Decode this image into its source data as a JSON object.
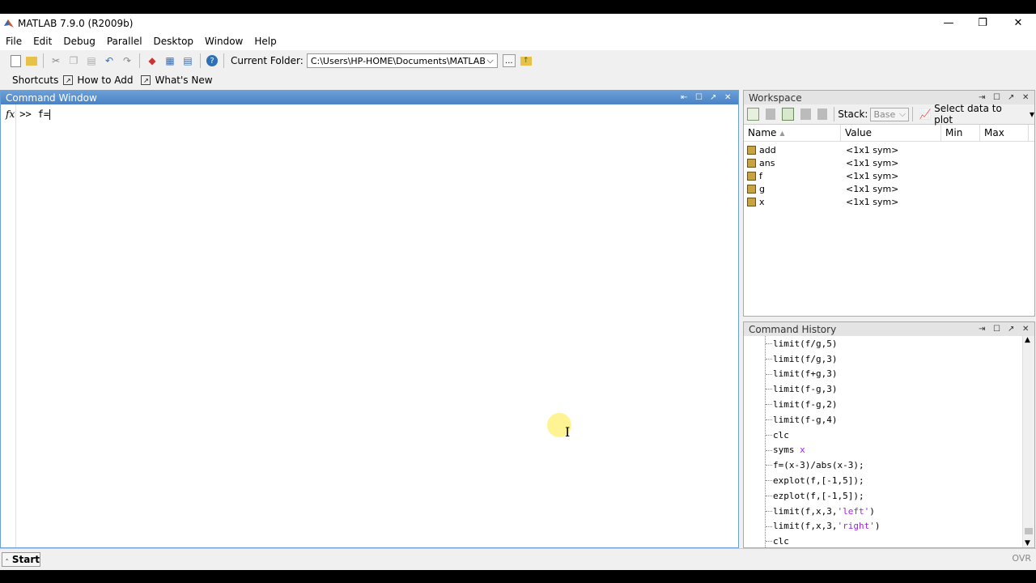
{
  "app": {
    "title": "MATLAB  7.9.0 (R2009b)",
    "window_controls": [
      "—",
      "❐",
      "✕"
    ]
  },
  "menu": [
    "File",
    "Edit",
    "Debug",
    "Parallel",
    "Desktop",
    "Window",
    "Help"
  ],
  "toolbar": {
    "current_folder_label": "Current Folder:",
    "current_folder_value": "C:\\Users\\HP-HOME\\Documents\\MATLAB",
    "browse_label": "..."
  },
  "shortcuts": {
    "label": "Shortcuts",
    "how_to_add": "How to Add",
    "whats_new": "What's New"
  },
  "command_window": {
    "title": "Command Window",
    "fx": "fx",
    "prompt": ">>",
    "input": "f="
  },
  "workspace": {
    "title": "Workspace",
    "stack_label": "Stack:",
    "stack_value": "Base",
    "plot_label": "Select data to plot",
    "columns": [
      "Name",
      "Value",
      "Min",
      "Max"
    ],
    "rows": [
      {
        "name": "add",
        "value": "<1x1 sym>"
      },
      {
        "name": "ans",
        "value": "<1x1 sym>"
      },
      {
        "name": "f",
        "value": "<1x1 sym>"
      },
      {
        "name": "g",
        "value": "<1x1 sym>"
      },
      {
        "name": "x",
        "value": "<1x1 sym>"
      }
    ]
  },
  "history": {
    "title": "Command History",
    "items": [
      {
        "text": "limit(f/g,5)"
      },
      {
        "text": "limit(f/g,3)"
      },
      {
        "text": "limit(f+g,3)"
      },
      {
        "text": "limit(f-g,3)"
      },
      {
        "text": "limit(f-g,2)"
      },
      {
        "text": "limit(f-g,4)"
      },
      {
        "text": "clc"
      },
      {
        "text": "syms ",
        "hl": "x",
        "after": ""
      },
      {
        "text": "f=(x-3)/abs(x-3);"
      },
      {
        "text": "explot(f,[-1,5]);"
      },
      {
        "text": "ezplot(f,[-1,5]);"
      },
      {
        "text": "limit(f,x,3,",
        "hl": "'left'",
        "after": ")"
      },
      {
        "text": "limit(f,x,3,",
        "hl": "'right'",
        "after": ")"
      },
      {
        "text": "clc"
      }
    ]
  },
  "status": {
    "start_label": "Start",
    "ovr": "OVR"
  },
  "colors": {
    "active_title": "#4a82c4",
    "string_purple": "#a020f0"
  }
}
